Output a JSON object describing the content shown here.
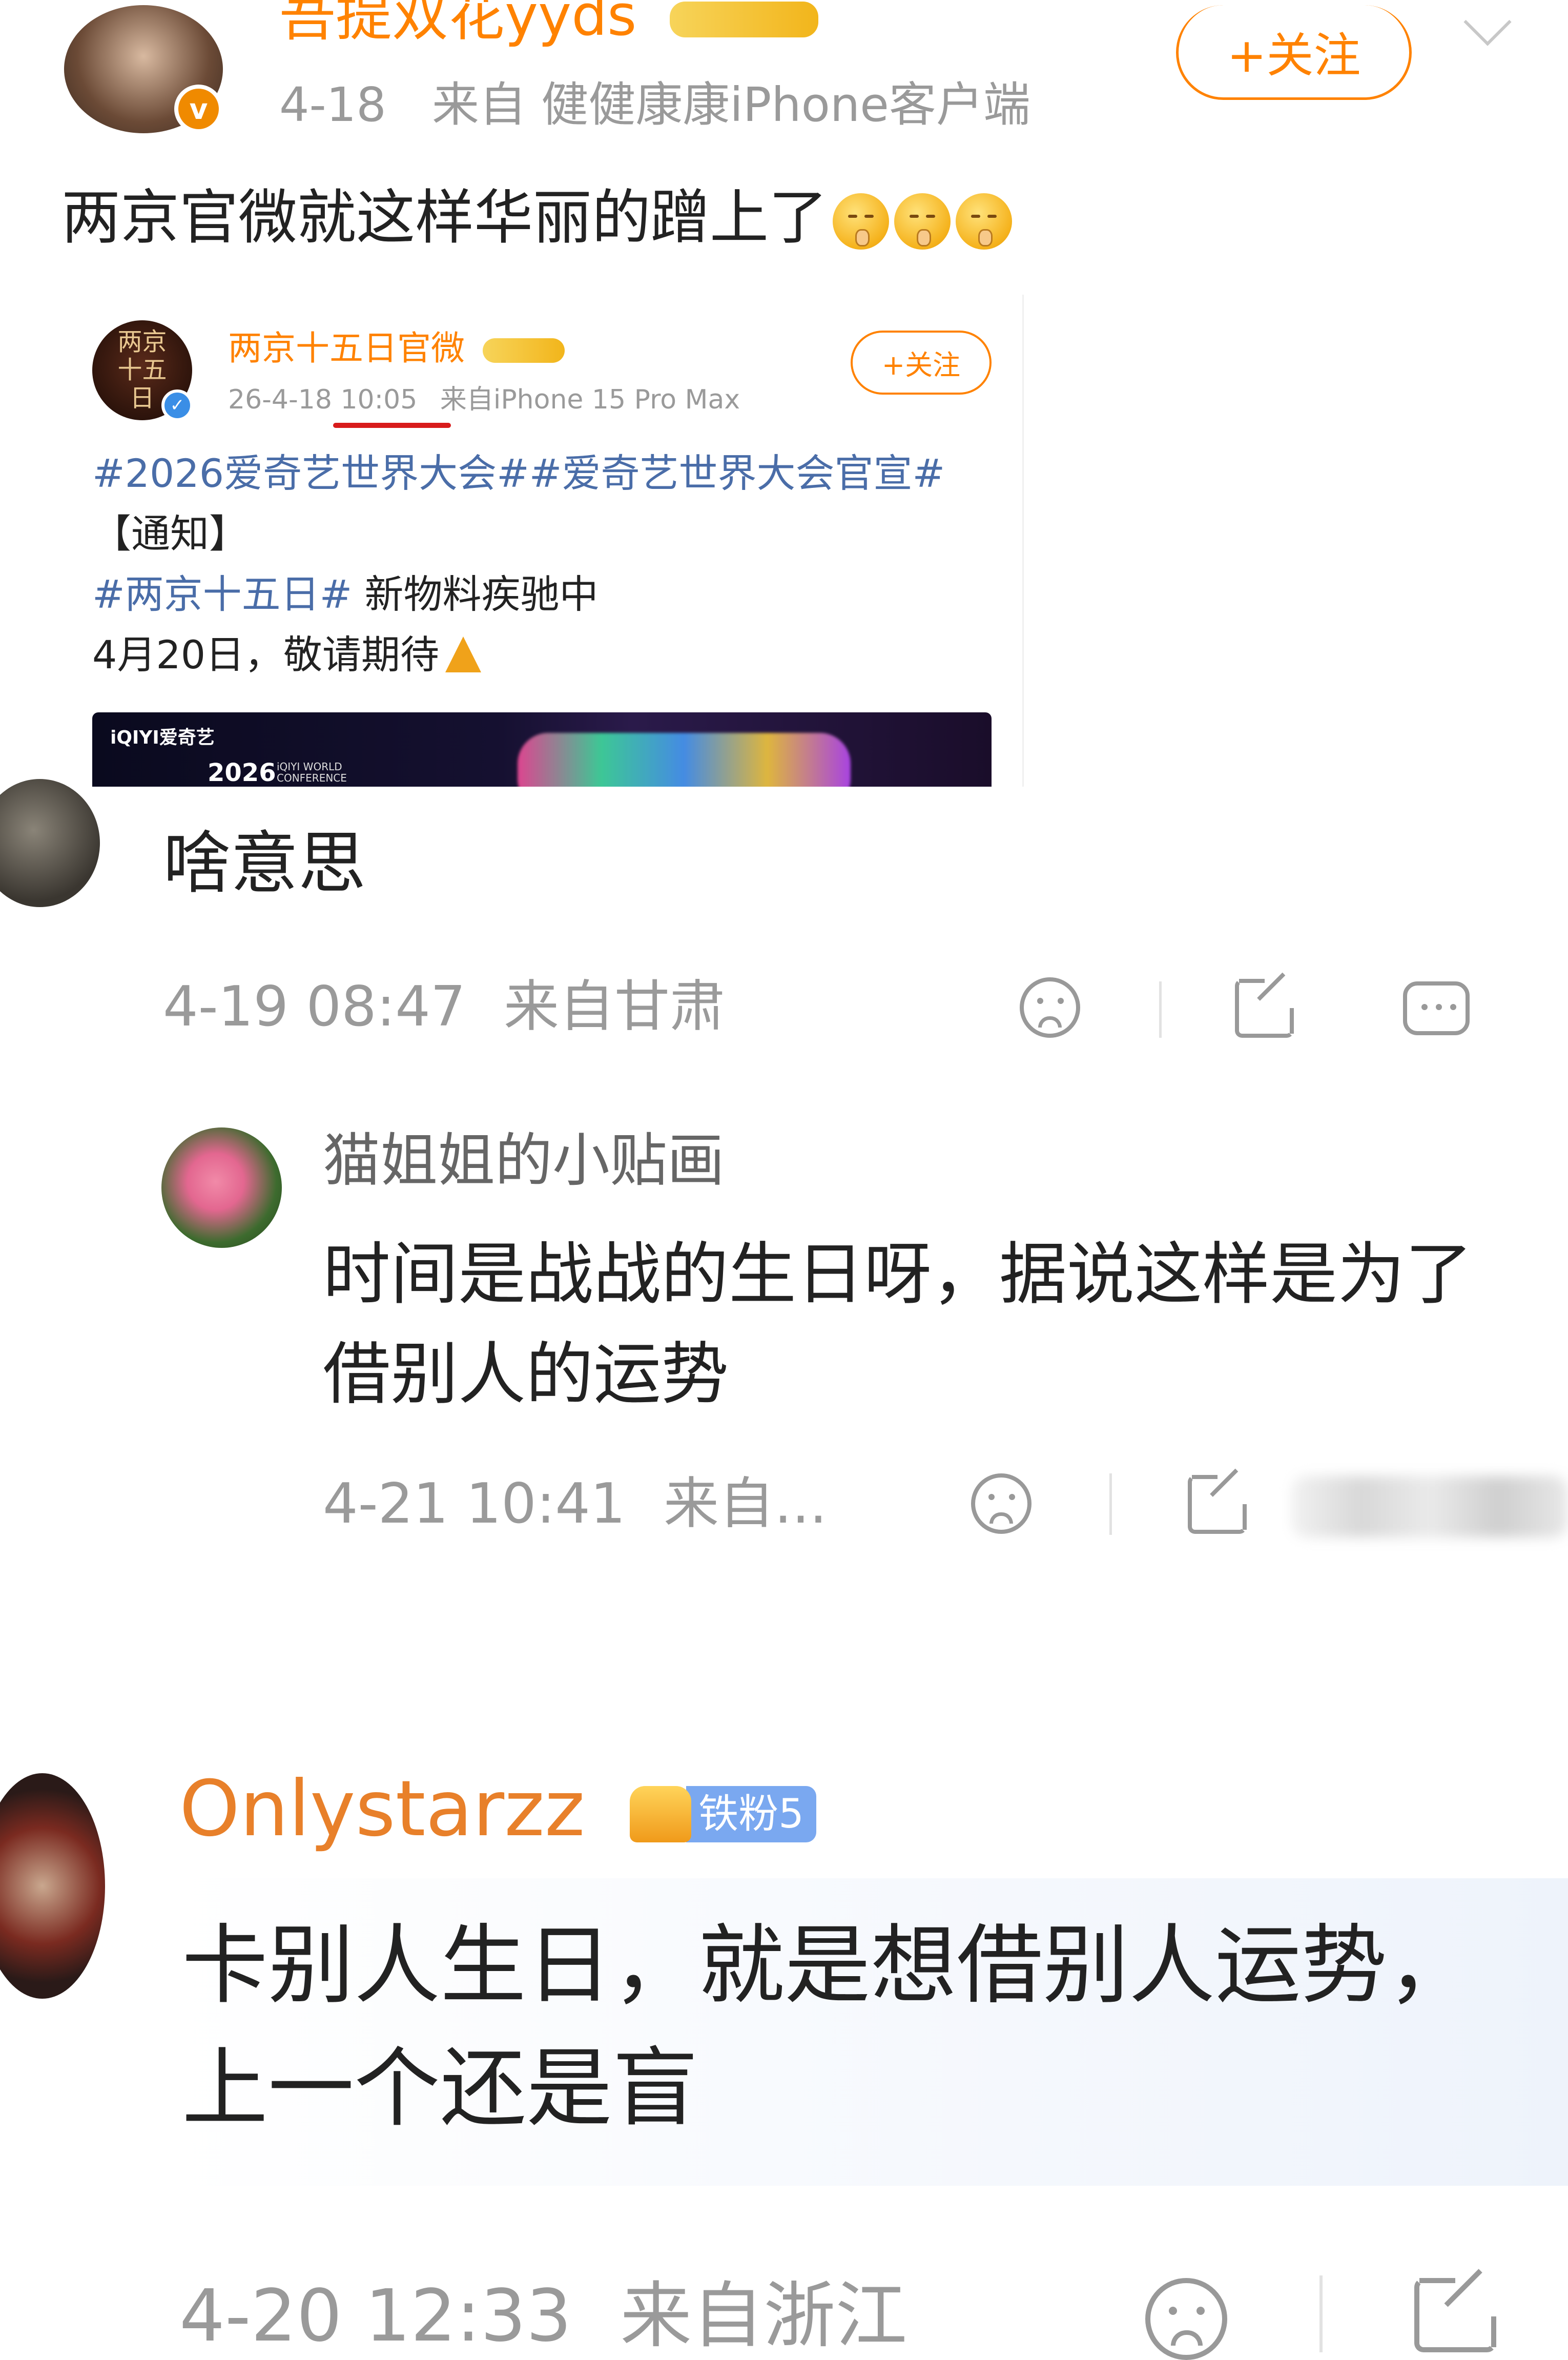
{
  "post": {
    "username": "吾提双花yyds",
    "time": "4-18",
    "source": "来自 健健康康iPhone客户端",
    "follow_label": "+关注",
    "content": "两京官微就这样华丽的蹭上了",
    "emoji_icon": "shush-face-icon"
  },
  "repost": {
    "username": "两京十五日官微",
    "time": "26-4-18 10:05",
    "source": "来自iPhone 15 Pro Max",
    "follow_label": "+关注",
    "avatar_text": "两京十五日",
    "line1": "#2026爱奇艺世界大会##爱奇艺世界大会官宣#",
    "line2": "【通知】",
    "line3_tag": "#两京十五日#",
    "line3_text": " 新物料疾驰中",
    "line4": "4月20日，敬请期待",
    "banner_logo": "iQIYI爱奇艺",
    "banner_year": "2026",
    "banner_sub": "iQIYI WORLD CONFERENCE",
    "accent": "#ff8200",
    "link_color": "#4a6da8"
  },
  "comment1": {
    "text": "啥意思",
    "time": "4-19 08:47",
    "source": "来自甘肃"
  },
  "reply1": {
    "username": "猫姐姐的小贴画",
    "text_line1": "时间是战战的生日呀，据说这样是为了",
    "text_line2": "借别人的运势",
    "time": "4-21 10:41",
    "source": "来自..."
  },
  "comment2": {
    "username": "Onlystarzz",
    "badge": "铁粉5",
    "text_line1": "卡别人生日，就是想借别人运势，",
    "text_line2": "上一个还是盲",
    "time": "4-20 12:33",
    "source": "来自浙江"
  }
}
